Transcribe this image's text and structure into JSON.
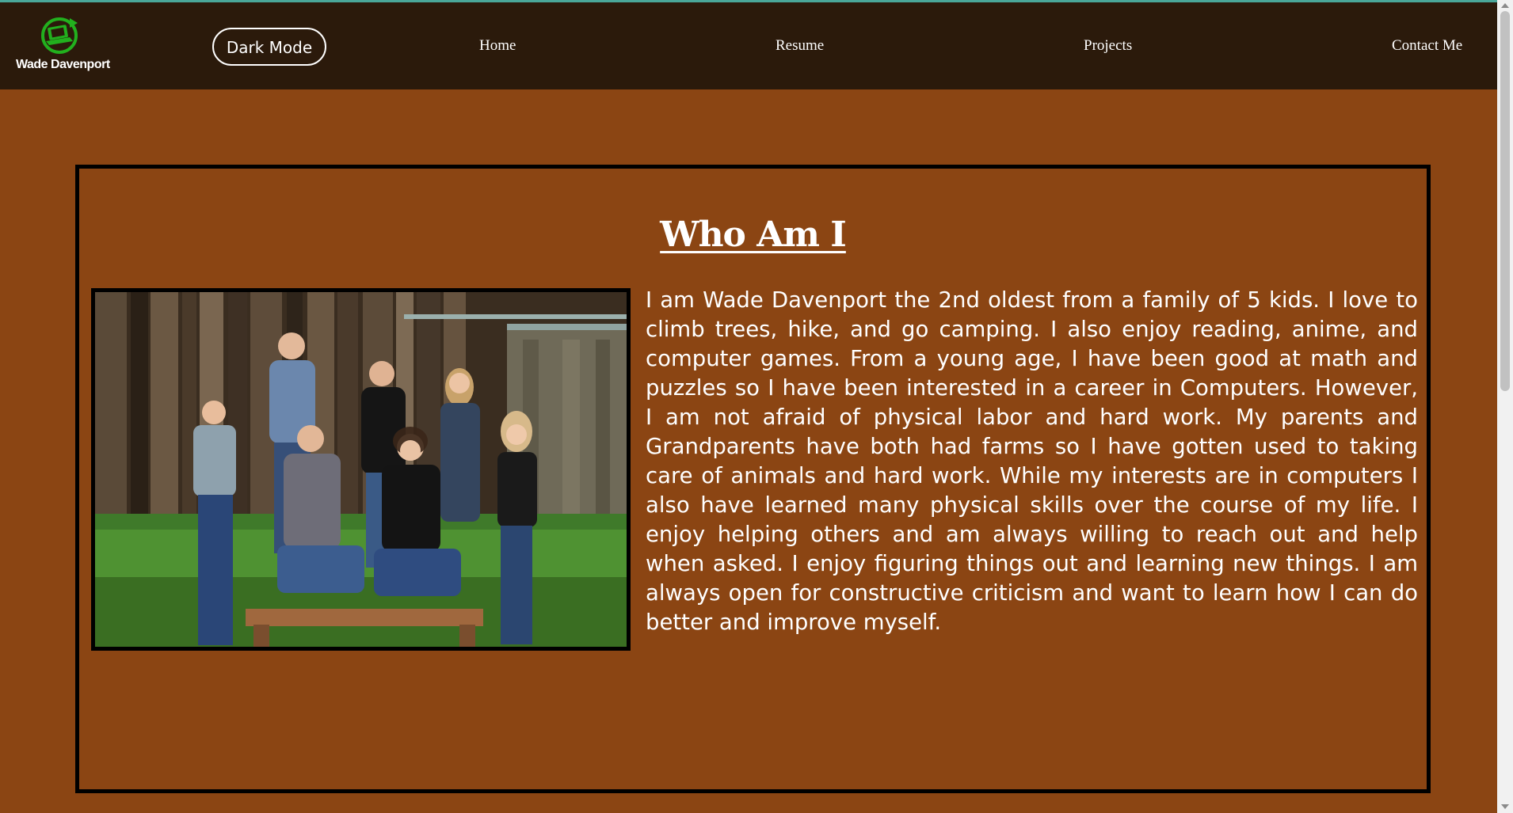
{
  "nav": {
    "brand_name": "Wade Davenport",
    "logo_icon": "laptop-refresh-icon",
    "dark_mode_label": "Dark Mode",
    "links": [
      {
        "label": "Home"
      },
      {
        "label": "Resume"
      },
      {
        "label": "Projects"
      },
      {
        "label": "Contact Me"
      }
    ]
  },
  "about": {
    "title": "Who Am I",
    "photo_alt": "Family photo",
    "paragraph": "I am Wade Davenport the 2nd oldest from a family of 5 kids. I love to climb trees, hike, and go camping. I also enjoy reading, anime, and computer games. From a young age, I have been good at math and puzzles so I have been interested in a career in Computers. However, I am not afraid of physical labor and hard work. My parents and Grandparents have both had farms so I have gotten used to taking care of animals and hard work. While my interests are in computers I also have learned many physical skills over the course of my life. I enjoy helping others and am always willing to reach out and help when asked. I enjoy figuring things out and learning new things. I am always open for constructive criticism and want to learn how I can do better and improve myself."
  },
  "colors": {
    "page_background": "#8b4513",
    "navbar_background": "#2b1a0b",
    "logo_green": "#22b01e",
    "text": "#ffffff",
    "border": "#000000"
  }
}
